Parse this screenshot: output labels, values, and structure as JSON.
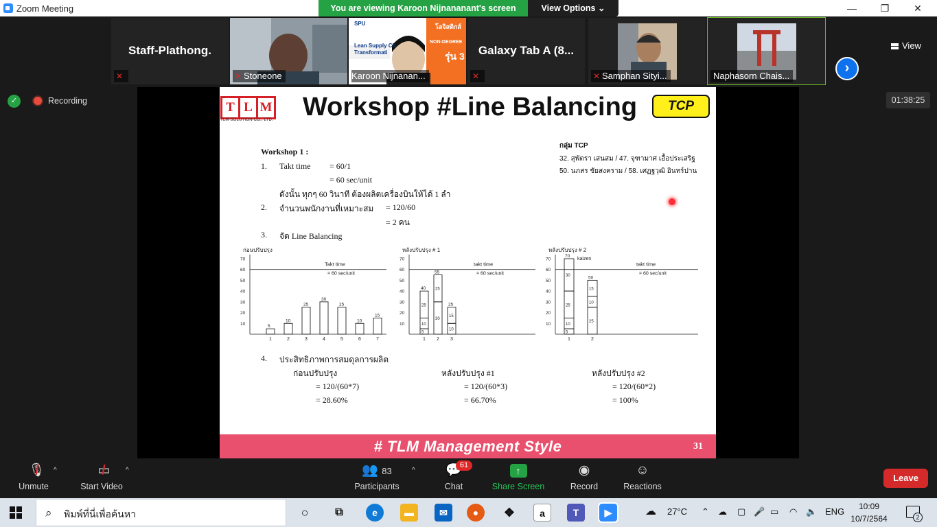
{
  "window": {
    "title": "Zoom Meeting",
    "minimize": "—",
    "maximize": "❐",
    "close": "✕"
  },
  "share_banner": {
    "text": "You are viewing Karoon Nijnananant's screen",
    "view_options": "View Options ⌄"
  },
  "gallery": {
    "tiles": [
      {
        "name": "Staff-Plathong.",
        "big": "Staff-Plathong.",
        "muted": true,
        "video": false
      },
      {
        "name": "Stoneone",
        "muted": true,
        "video": true
      },
      {
        "name": "Karoon Nijnanan...",
        "muted": false,
        "video": true
      },
      {
        "name": "Galaxy Tab A (8...",
        "big": "Galaxy Tab A (8...",
        "muted": true,
        "video": false
      },
      {
        "name": "Samphan Sityi...",
        "muted": true,
        "video": true
      },
      {
        "name": "Naphasorn Chais...",
        "muted": false,
        "video": true,
        "active": true
      }
    ],
    "karoon_slide": {
      "brand": "SPU",
      "l1": "Lean Supply Ch",
      "l2": "Transformati",
      "l3": "โลจิสติกส์",
      "l4": "NON-DEGREE",
      "l5": "รุ่น 3"
    },
    "view_label": "View"
  },
  "recording": {
    "label": "Recording",
    "timer": "01:38:25"
  },
  "slide": {
    "logo_letters": [
      "T",
      "L",
      "M"
    ],
    "logo_sub": "TLM SOLUTION CO., LTD.",
    "title": "Workshop #Line Balancing",
    "badge": "TCP",
    "group": {
      "title": "กลุ่ม TCP",
      "line1": "32. สุพัตรา เสนสม     / 47. จุฑามาศ  เอื้อประเสริฐ",
      "line2": "50. นภสร ชัยสงคราม / 58. เศฏฐวุฒิ อินทร์ปาน"
    },
    "workshop": {
      "heading": "Workshop 1 :",
      "n1": "1.",
      "takt_label": "Takt time",
      "takt_eq1": "=   60/1",
      "takt_eq2": "=   60 sec/unit",
      "thai_line": "ดังนั้น ทุกๆ 60 วินาที ต้องผลิตเครื่องบินให้ได้ 1 ลำ",
      "n2": "2.",
      "workers_label": "จำนวนพนักงานที่เหมาะสม",
      "workers_eq1": "=   120/60",
      "workers_eq2": "=   2 คน",
      "n3": "3.",
      "balance_label": "จัด Line Balancing",
      "n4": "4.",
      "eff_label": "ประสิทธิภาพการสมดุลการผลิต",
      "eff_cols": [
        {
          "label": "ก่อนปรับปรุง",
          "eq1": "=   120/(60*7)",
          "eq2": "=   28.60%"
        },
        {
          "label": "หลังปรับปรุง #1",
          "eq1": "=   120/(60*3)",
          "eq2": "=   66.70%"
        },
        {
          "label": "หลังปรับปรุง #2",
          "eq1": "=   120/(60*2)",
          "eq2": "=   100%"
        }
      ]
    },
    "footer": "# TLM Management Style",
    "page_number": "31"
  },
  "chart_data": [
    {
      "type": "bar",
      "title": "ก่อนปรับปรุง",
      "categories": [
        "1",
        "2",
        "3",
        "4",
        "5",
        "6",
        "7"
      ],
      "values": [
        5,
        10,
        25,
        30,
        25,
        10,
        15
      ],
      "ylim": [
        0,
        70
      ],
      "yticks": [
        "10",
        "20",
        "30",
        "40",
        "50",
        "60",
        "70"
      ],
      "reference_line": {
        "value": 60,
        "label1": "Takt time",
        "label2": "= 60 sec/unit"
      }
    },
    {
      "type": "bar",
      "title": "หลังปรับปรุง # 1",
      "categories": [
        "1",
        "2",
        "3"
      ],
      "series": [
        {
          "segments": [
            5,
            10,
            25
          ]
        },
        {
          "segments": [
            30,
            25
          ]
        },
        {
          "segments": [
            10,
            15
          ]
        }
      ],
      "segment_labels": [
        [
          "5",
          "10",
          "25",
          "40"
        ],
        [
          "30",
          "25",
          "55"
        ],
        [
          "10",
          "15",
          "25"
        ]
      ],
      "ylim": [
        0,
        70
      ],
      "yticks": [
        "10",
        "20",
        "30",
        "40",
        "50",
        "60",
        "70"
      ],
      "reference_line": {
        "value": 60,
        "label1": "takt time",
        "label2": "= 60 sec/unit"
      }
    },
    {
      "type": "bar",
      "title": "หลังปรับปรุง # 2",
      "categories": [
        "1",
        "2"
      ],
      "series": [
        {
          "segments": [
            5,
            10,
            25,
            30
          ]
        },
        {
          "segments": [
            25,
            10,
            15
          ]
        }
      ],
      "segment_labels": [
        [
          "5",
          "10",
          "25",
          "30",
          "70"
        ],
        [
          "25",
          "10",
          "15",
          "50"
        ]
      ],
      "annotation": "kaizen",
      "ylim": [
        0,
        70
      ],
      "yticks": [
        "10",
        "20",
        "30",
        "40",
        "50",
        "60",
        "70"
      ],
      "reference_line": {
        "value": 60,
        "label1": "takt time",
        "label2": "= 60 sec/unit"
      }
    }
  ],
  "toolbar": {
    "unmute": "Unmute",
    "start_video": "Start Video",
    "participants": "Participants",
    "participants_count": "83",
    "chat": "Chat",
    "chat_badge": "61",
    "share_screen": "Share Screen",
    "record": "Record",
    "reactions": "Reactions",
    "leave": "Leave"
  },
  "taskbar": {
    "search_placeholder": "พิมพ์ที่นี่เพื่อค้นหา",
    "weather": "27°C",
    "lang": "ENG",
    "time": "10:09",
    "date": "10/7/2564",
    "notifications": "2",
    "amazon_glyph": "a"
  },
  "colors": {
    "zoom_blue": "#2d8cff",
    "banner_green": "#25a244",
    "leave_red": "#d42a2a",
    "footer_pink": "#e8506d",
    "badge_yellow": "#ffef1a"
  }
}
